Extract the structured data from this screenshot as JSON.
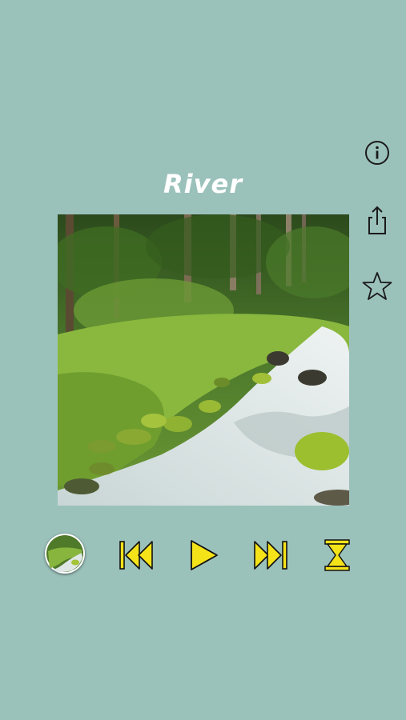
{
  "track": {
    "title": "River"
  },
  "side_actions": [
    {
      "name": "info",
      "icon": "info-icon"
    },
    {
      "name": "share",
      "icon": "share-icon"
    },
    {
      "name": "favorite",
      "icon": "star-icon"
    }
  ],
  "artwork": {
    "description_icon": "forest-river-image"
  },
  "controls": [
    {
      "name": "track-thumbnail",
      "icon": "river-thumbnail"
    },
    {
      "name": "previous",
      "icon": "skip-previous-icon"
    },
    {
      "name": "play",
      "icon": "play-icon"
    },
    {
      "name": "next",
      "icon": "skip-next-icon"
    },
    {
      "name": "sleep-timer",
      "icon": "hourglass-icon"
    }
  ],
  "colors": {
    "background": "#9bc1bb",
    "title": "#ffffff",
    "control_fill": "#f5e31a",
    "control_stroke": "#111111",
    "side_icon_stroke": "#1a1a1a"
  }
}
